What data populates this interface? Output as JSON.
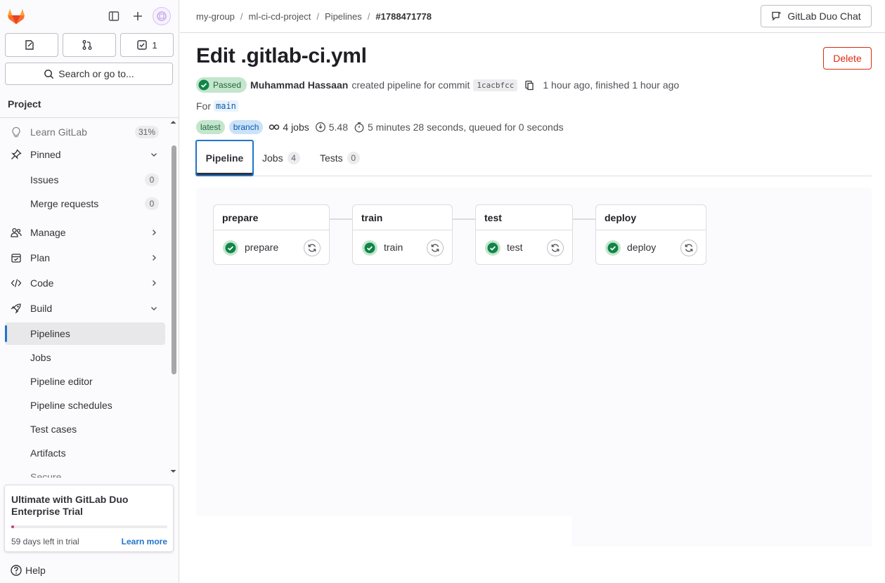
{
  "sidebar": {
    "counts": {
      "issues": "",
      "merge_requests": "",
      "todos": "1"
    },
    "search_label": "Search or go to...",
    "project_heading": "Project",
    "items": {
      "learn": {
        "label": "Learn GitLab",
        "badge": "31%"
      },
      "pinned": {
        "label": "Pinned"
      },
      "issues": {
        "label": "Issues",
        "count": "0"
      },
      "merge_requests": {
        "label": "Merge requests",
        "count": "0"
      },
      "manage": {
        "label": "Manage"
      },
      "plan": {
        "label": "Plan"
      },
      "code": {
        "label": "Code"
      },
      "build": {
        "label": "Build"
      },
      "pipelines": {
        "label": "Pipelines"
      },
      "jobs": {
        "label": "Jobs"
      },
      "pipeline_editor": {
        "label": "Pipeline editor"
      },
      "pipeline_schedules": {
        "label": "Pipeline schedules"
      },
      "test_cases": {
        "label": "Test cases"
      },
      "artifacts": {
        "label": "Artifacts"
      },
      "secure": {
        "label": "Secure"
      }
    },
    "trial": {
      "title": "Ultimate with GitLab Duo Enterprise Trial",
      "days_left": "59 days left in trial",
      "learn_more": "Learn more",
      "progress": 0.02
    },
    "help": "Help"
  },
  "breadcrumb": [
    "my-group",
    "ml-ci-cd-project",
    "Pipelines",
    "#1788471778"
  ],
  "duo_chat_label": "GitLab Duo Chat",
  "page": {
    "title": "Edit .gitlab-ci.yml",
    "delete_label": "Delete",
    "status": "Passed",
    "author": "Muhammad Hassaan",
    "created_text": "created pipeline for commit",
    "commit_sha": "1cacbfcc",
    "time_text": "1 hour ago, finished 1 hour ago",
    "for_label": "For",
    "ref": "main",
    "badges": [
      "latest",
      "branch"
    ],
    "jobs_count_text": "4 jobs",
    "compute": "5.48",
    "duration_text": "5 minutes 28 seconds, queued for 0 seconds"
  },
  "tabs": [
    {
      "label": "Pipeline"
    },
    {
      "label": "Jobs",
      "count": "4"
    },
    {
      "label": "Tests",
      "count": "0"
    }
  ],
  "stages": [
    {
      "name": "prepare",
      "job": "prepare",
      "status": "passed"
    },
    {
      "name": "train",
      "job": "train",
      "status": "passed"
    },
    {
      "name": "test",
      "job": "test",
      "status": "passed"
    },
    {
      "name": "deploy",
      "job": "deploy",
      "status": "passed"
    }
  ],
  "colors": {
    "success": "#108548",
    "link": "#1f75cb",
    "danger": "#dd2b0e"
  }
}
